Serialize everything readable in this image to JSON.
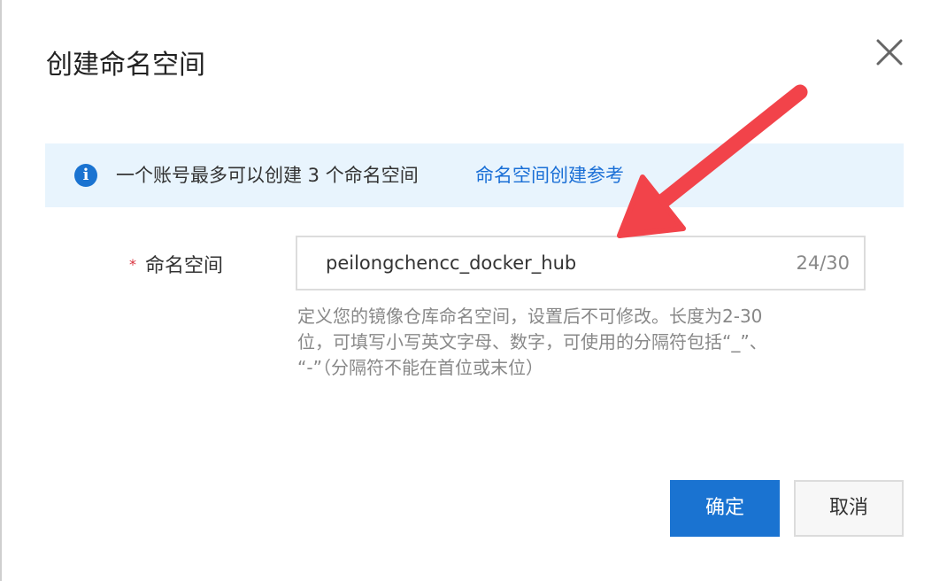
{
  "dialog": {
    "title": "创建命名空间",
    "close_icon": "close-icon"
  },
  "notice": {
    "icon": "info-icon",
    "icon_glyph": "i",
    "message": "一个账号最多可以创建 3 个命名空间",
    "link": "命名空间创建参考",
    "link_color": "#1a6fd6",
    "background": "#e8f4fd"
  },
  "form": {
    "required_mark": "*",
    "label": "命名空间",
    "value": "peilongchencc_docker_hub",
    "counter": "24/30",
    "help_lines": [
      "定义您的镜像仓库命名空间，设置后不可修改。长度为2-30",
      "位，可填写小写英文字母、数字，可使用的分隔符包括“_”、",
      "“-”（分隔符不能在首位或末位）"
    ]
  },
  "buttons": {
    "ok": "确定",
    "cancel": "取消",
    "primary_color": "#1a73d1"
  },
  "annotation": {
    "arrow_color": "#f2434a"
  }
}
